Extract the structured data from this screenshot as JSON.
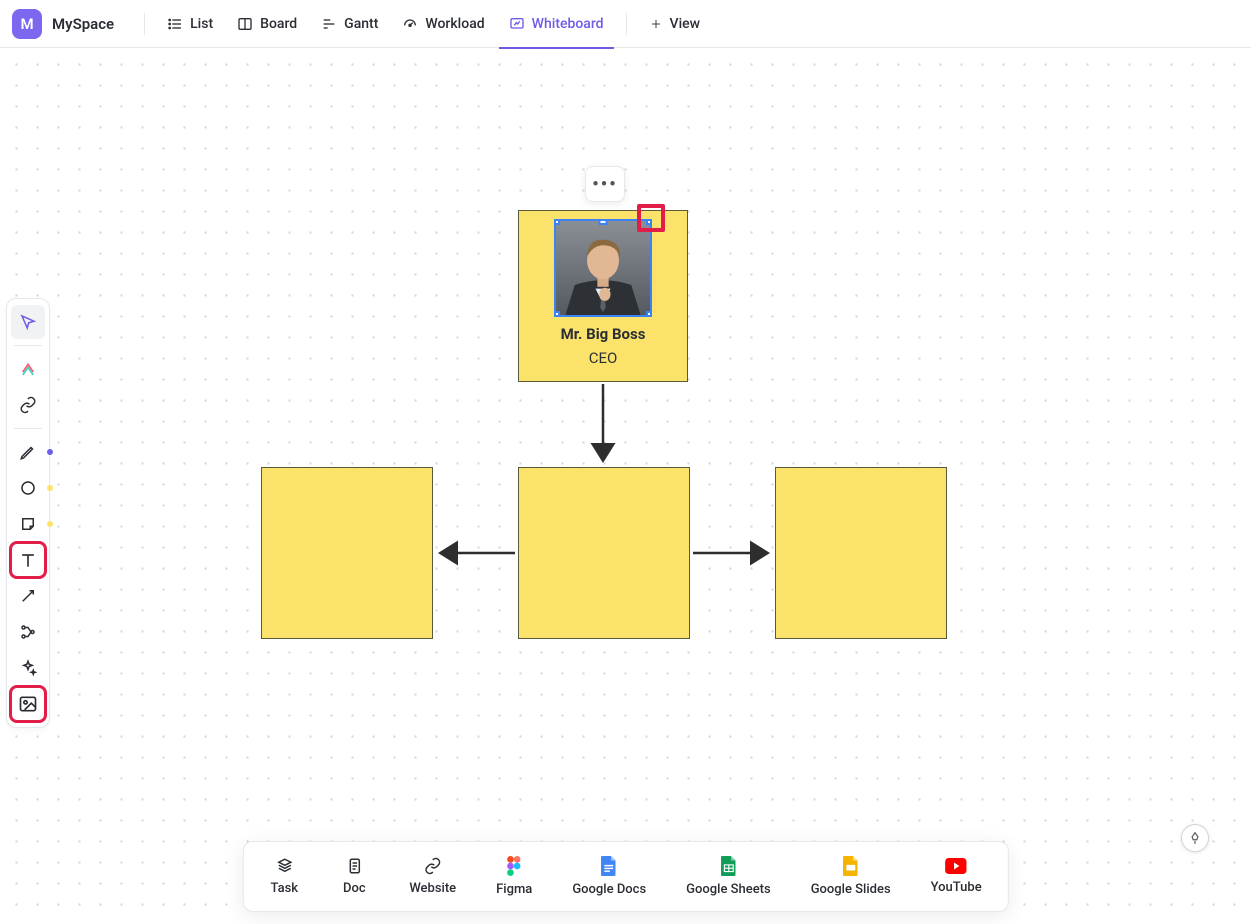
{
  "space": {
    "badge_letter": "M",
    "name": "MySpace"
  },
  "nav": {
    "list": "List",
    "board": "Board",
    "gantt": "Gantt",
    "workload": "Workload",
    "whiteboard": "Whiteboard",
    "add_view": "View"
  },
  "org": {
    "boss_name": "Mr. Big Boss",
    "boss_title": "CEO"
  },
  "bottom": {
    "task": "Task",
    "doc": "Doc",
    "website": "Website",
    "figma": "Figma",
    "gdocs": "Google Docs",
    "gsheets": "Google Sheets",
    "gslides": "Google Slides",
    "youtube": "YouTube"
  }
}
